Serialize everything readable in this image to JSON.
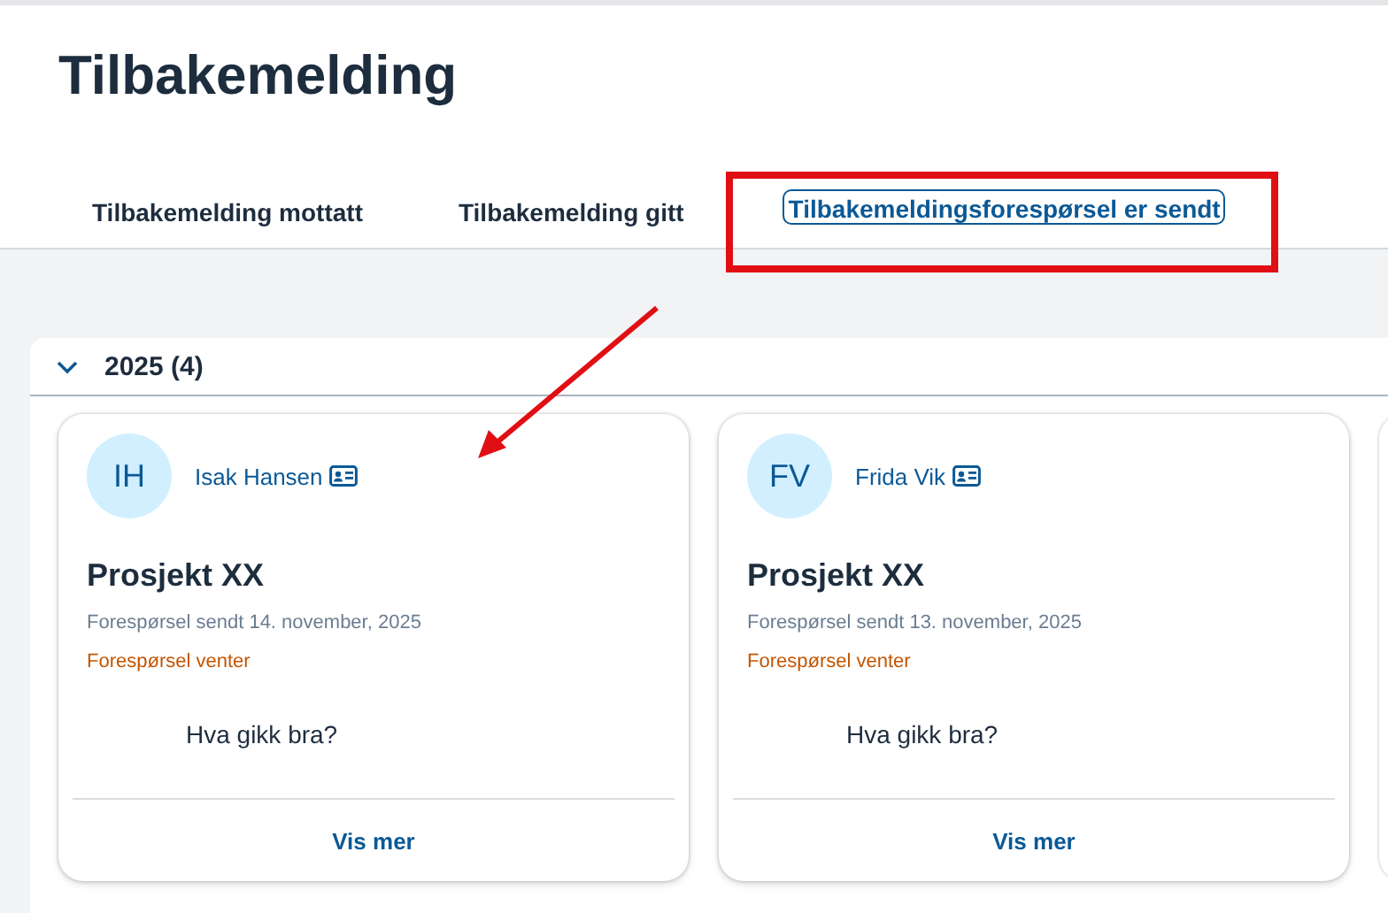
{
  "page": {
    "title": "Tilbakemelding"
  },
  "tabs": [
    {
      "label": "Tilbakemelding mottatt",
      "selected": false,
      "highlighted": false
    },
    {
      "label": "Tilbakemelding gitt",
      "selected": false,
      "highlighted": false
    },
    {
      "label": "Tilbakemeldingsforespørsel er sendt",
      "selected": true,
      "highlighted": true
    }
  ],
  "group": {
    "label": "2025 (4)",
    "expanded": true
  },
  "cards": [
    {
      "kind": "full",
      "initials": "IH",
      "name": "Isak Hansen",
      "title": "Prosjekt XX",
      "date": "Forespørsel sendt 14. november, 2025",
      "status": "Forespørsel venter",
      "question": "Hva gikk bra?",
      "action": "Vis mer",
      "pointed": true
    },
    {
      "kind": "full",
      "initials": "FV",
      "name": "Frida Vik",
      "title": "Prosjekt XX",
      "date": "Forespørsel sendt 13. november, 2025",
      "status": "Forespørsel venter",
      "question": "Hva gikk bra?",
      "action": "Vis mer",
      "pointed": false
    },
    {
      "kind": "partial"
    }
  ]
}
